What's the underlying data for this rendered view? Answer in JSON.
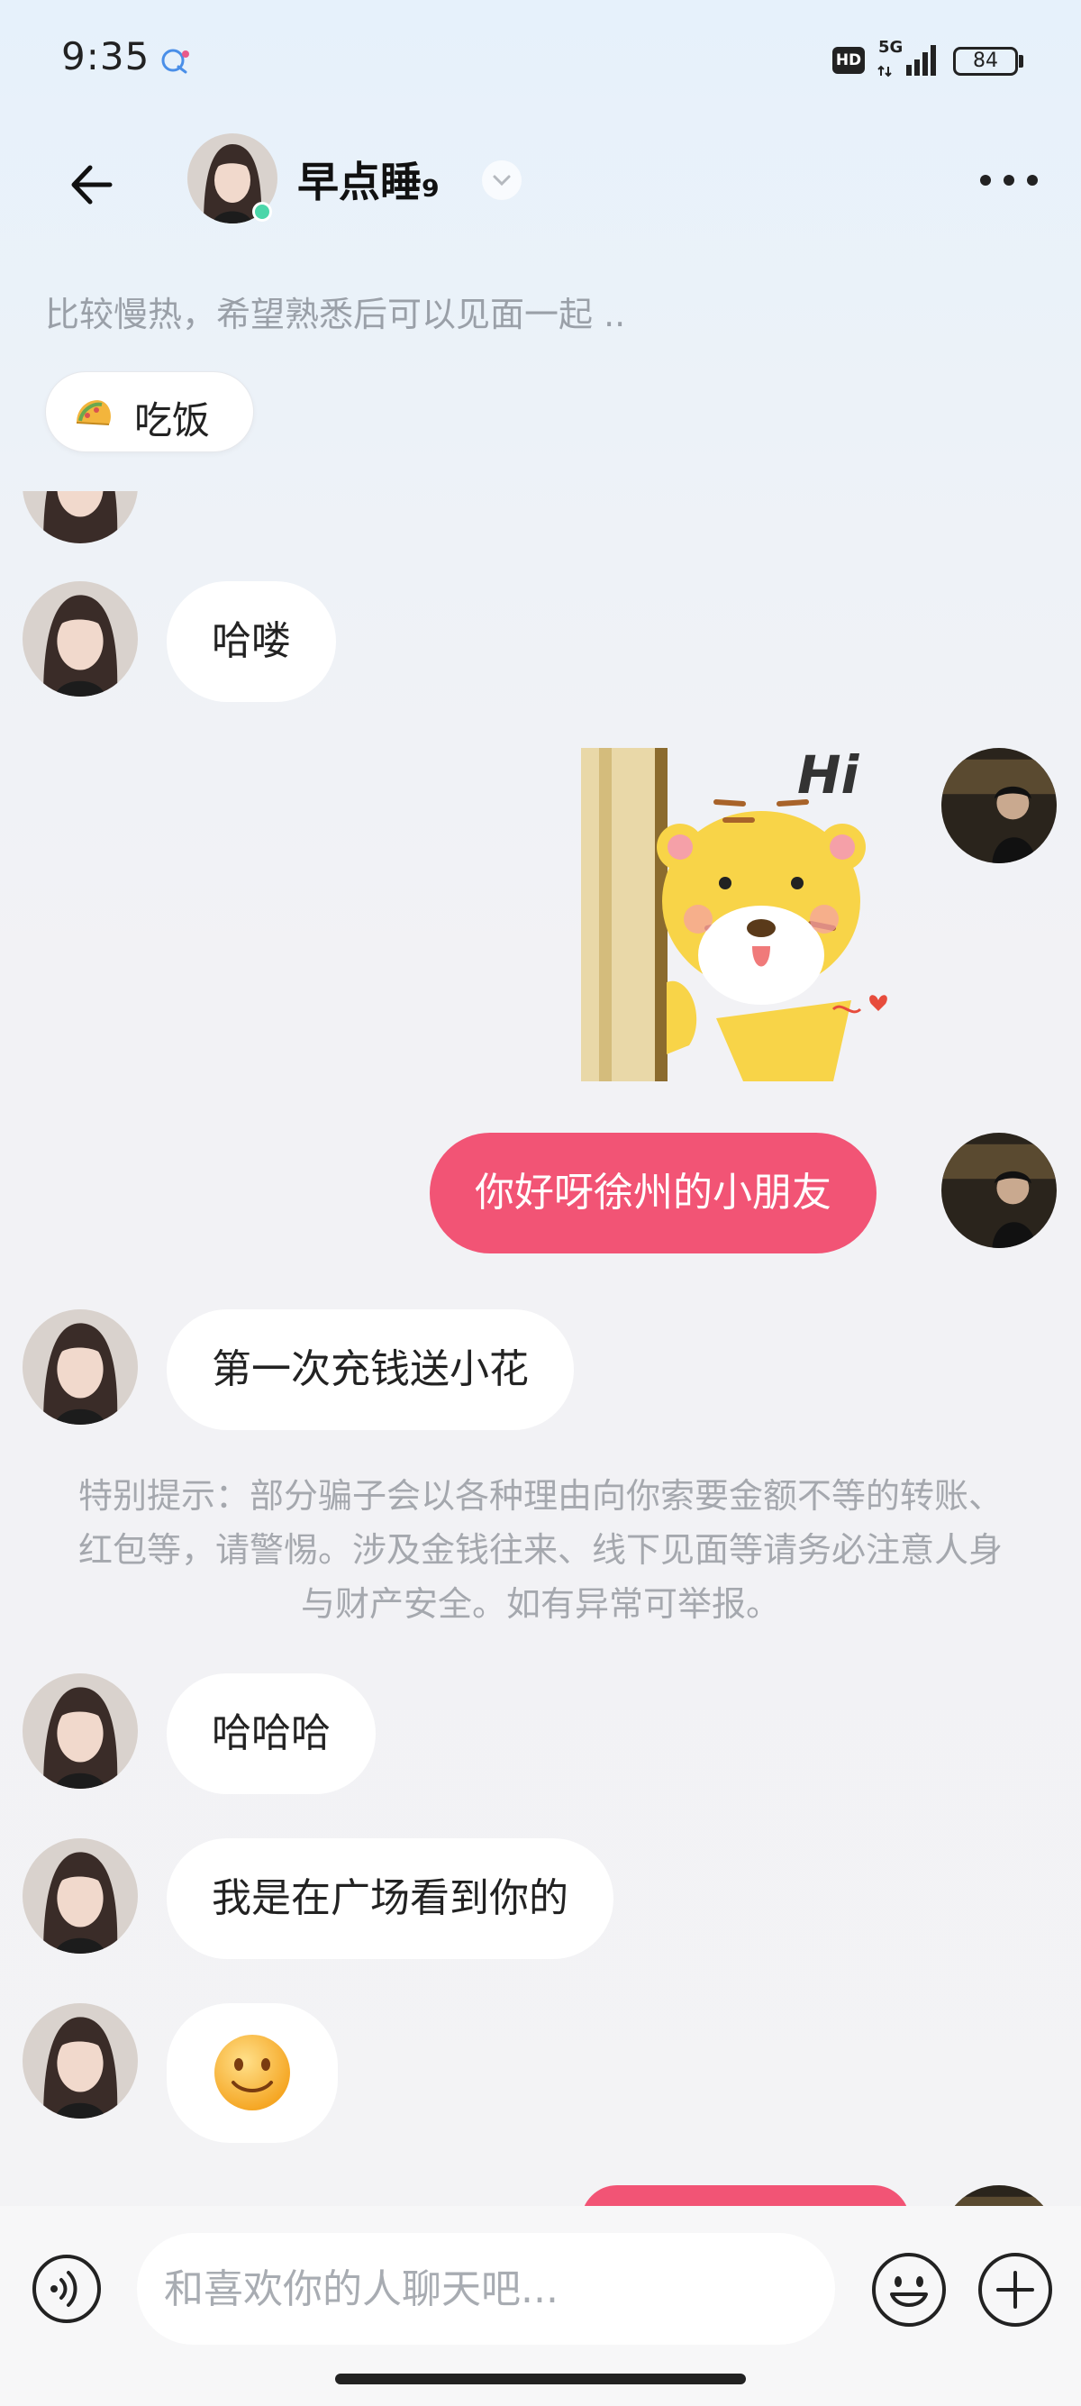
{
  "status_bar": {
    "time": "9:35",
    "hd": "HD",
    "network": "5G",
    "battery": "84"
  },
  "header": {
    "contact_name": "早点睡₉",
    "online": true
  },
  "profile": {
    "note": "比较慢热，希望熟悉后可以见面一起 ..",
    "tag": {
      "emoji": "taco-icon",
      "label": "吃饭"
    }
  },
  "messages": [
    {
      "from": "them",
      "text": "哈喽"
    },
    {
      "from": "me",
      "type": "sticker",
      "sticker_text": "Hi"
    },
    {
      "from": "me",
      "text": "你好呀徐州的小朋友"
    },
    {
      "from": "them",
      "text": "第一次充钱送小花"
    },
    {
      "from": "system",
      "text": "特别提示：部分骗子会以各种理由向你索要金额不等的转账、红包等，请警惕。涉及金钱往来、线下见面等请务必注意人身与财产安全。如有异常可举报。"
    },
    {
      "from": "them",
      "text": "哈哈哈"
    },
    {
      "from": "them",
      "text": "我是在广场看到你的"
    },
    {
      "from": "them",
      "type": "emoji",
      "emoji": "smile-icon"
    }
  ],
  "input": {
    "placeholder": "和喜欢你的人聊天吧..."
  },
  "colors": {
    "accent_pink": "#f25475",
    "online_green": "#4bd6a9"
  }
}
